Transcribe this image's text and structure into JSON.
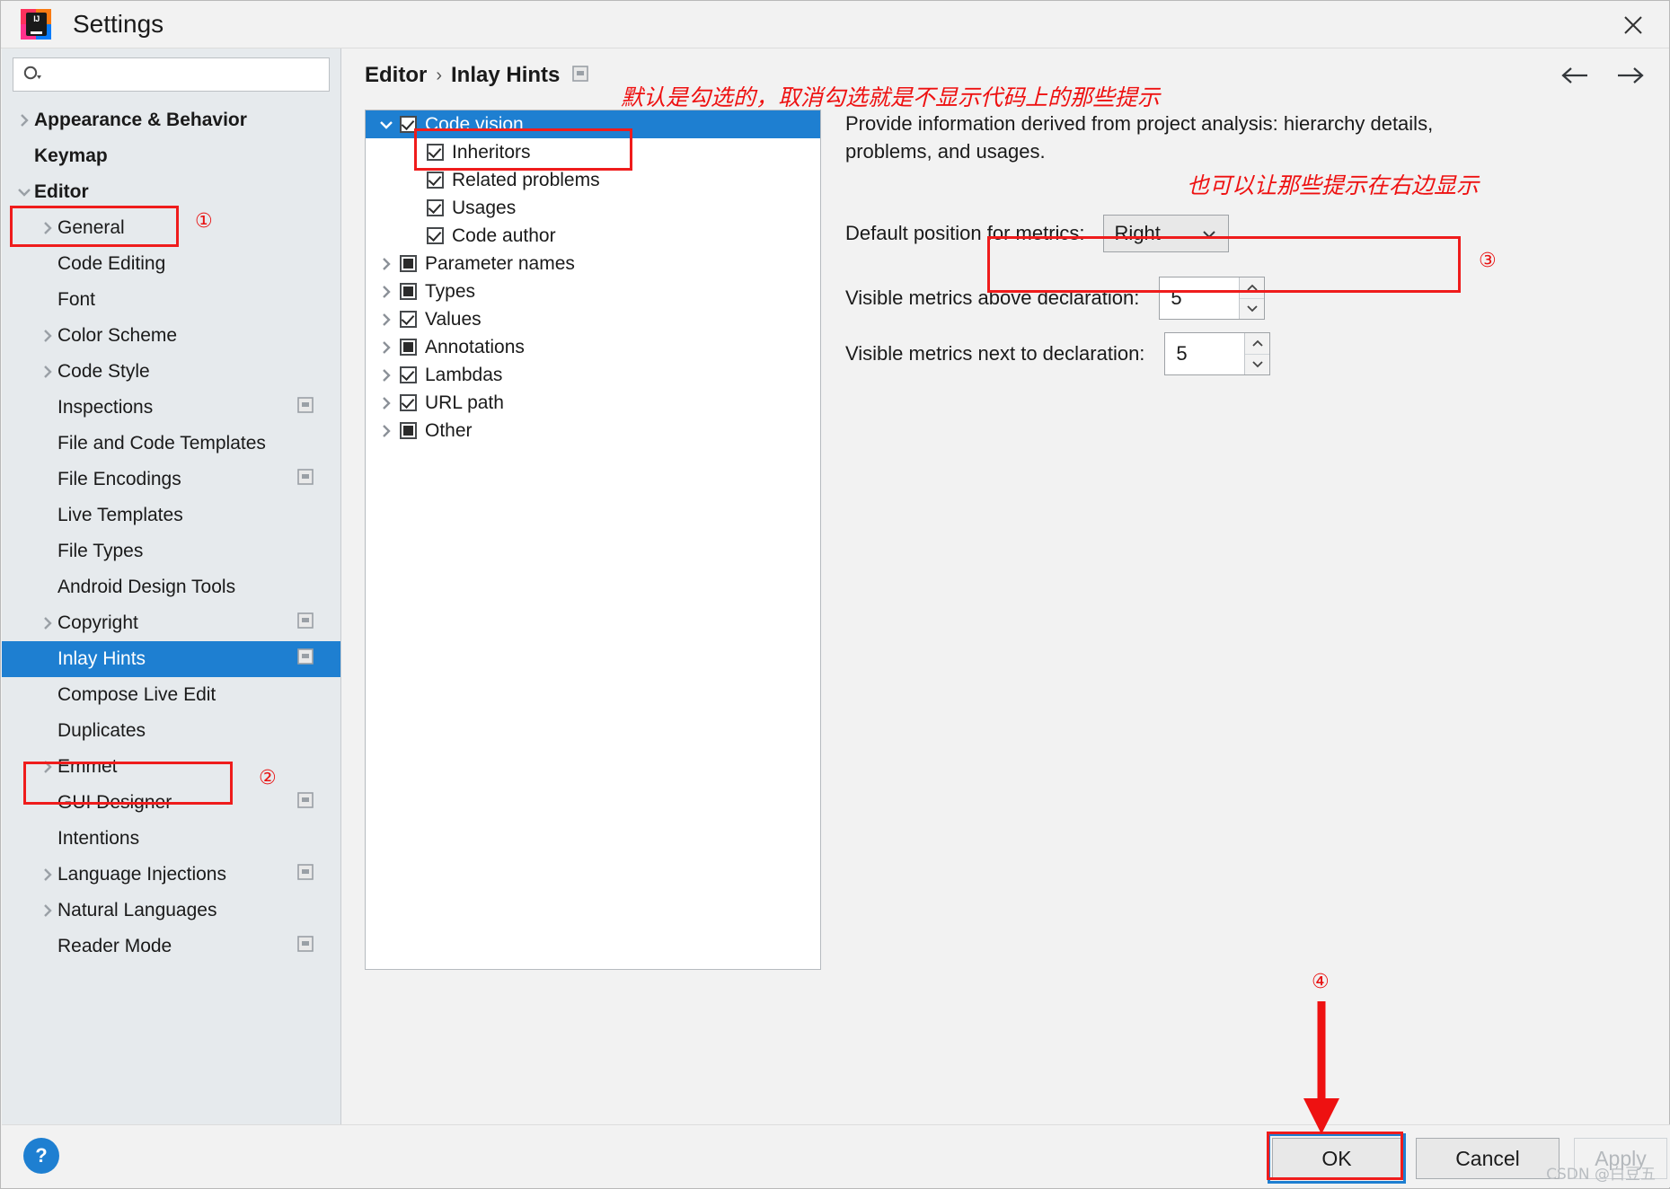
{
  "window": {
    "title": "Settings",
    "logo_text": "IJ",
    "close_icon": "close-icon"
  },
  "search": {
    "value": "",
    "placeholder": "",
    "icon": "search-icon"
  },
  "sidebar": {
    "items": [
      {
        "label": "Appearance & Behavior",
        "indent": 0,
        "twisty": "right",
        "bold": true,
        "selected": false,
        "badge": false
      },
      {
        "label": "Keymap",
        "indent": 0,
        "twisty": "none",
        "bold": true,
        "selected": false,
        "badge": false
      },
      {
        "label": "Editor",
        "indent": 0,
        "twisty": "down",
        "bold": true,
        "selected": false,
        "badge": false
      },
      {
        "label": "General",
        "indent": 1,
        "twisty": "right",
        "bold": false,
        "selected": false,
        "badge": false
      },
      {
        "label": "Code Editing",
        "indent": 1,
        "twisty": "none",
        "bold": false,
        "selected": false,
        "badge": false
      },
      {
        "label": "Font",
        "indent": 1,
        "twisty": "none",
        "bold": false,
        "selected": false,
        "badge": false
      },
      {
        "label": "Color Scheme",
        "indent": 1,
        "twisty": "right",
        "bold": false,
        "selected": false,
        "badge": false
      },
      {
        "label": "Code Style",
        "indent": 1,
        "twisty": "right",
        "bold": false,
        "selected": false,
        "badge": false
      },
      {
        "label": "Inspections",
        "indent": 1,
        "twisty": "none",
        "bold": false,
        "selected": false,
        "badge": true
      },
      {
        "label": "File and Code Templates",
        "indent": 1,
        "twisty": "none",
        "bold": false,
        "selected": false,
        "badge": false
      },
      {
        "label": "File Encodings",
        "indent": 1,
        "twisty": "none",
        "bold": false,
        "selected": false,
        "badge": true
      },
      {
        "label": "Live Templates",
        "indent": 1,
        "twisty": "none",
        "bold": false,
        "selected": false,
        "badge": false
      },
      {
        "label": "File Types",
        "indent": 1,
        "twisty": "none",
        "bold": false,
        "selected": false,
        "badge": false
      },
      {
        "label": "Android Design Tools",
        "indent": 1,
        "twisty": "none",
        "bold": false,
        "selected": false,
        "badge": false
      },
      {
        "label": "Copyright",
        "indent": 1,
        "twisty": "right",
        "bold": false,
        "selected": false,
        "badge": true
      },
      {
        "label": "Inlay Hints",
        "indent": 1,
        "twisty": "none",
        "bold": false,
        "selected": true,
        "badge": true
      },
      {
        "label": "Compose Live Edit",
        "indent": 1,
        "twisty": "none",
        "bold": false,
        "selected": false,
        "badge": false
      },
      {
        "label": "Duplicates",
        "indent": 1,
        "twisty": "none",
        "bold": false,
        "selected": false,
        "badge": false
      },
      {
        "label": "Emmet",
        "indent": 1,
        "twisty": "right",
        "bold": false,
        "selected": false,
        "badge": false
      },
      {
        "label": "GUI Designer",
        "indent": 1,
        "twisty": "none",
        "bold": false,
        "selected": false,
        "badge": true
      },
      {
        "label": "Intentions",
        "indent": 1,
        "twisty": "none",
        "bold": false,
        "selected": false,
        "badge": false
      },
      {
        "label": "Language Injections",
        "indent": 1,
        "twisty": "right",
        "bold": false,
        "selected": false,
        "badge": true
      },
      {
        "label": "Natural Languages",
        "indent": 1,
        "twisty": "right",
        "bold": false,
        "selected": false,
        "badge": false
      },
      {
        "label": "Reader Mode",
        "indent": 1,
        "twisty": "none",
        "bold": false,
        "selected": false,
        "badge": true
      }
    ]
  },
  "breadcrumb": {
    "root": "Editor",
    "separator": "›",
    "current": "Inlay Hints",
    "settings_icon": "settings-page-icon"
  },
  "nav": {
    "back_icon": "arrow-left-icon",
    "forward_icon": "arrow-right-icon"
  },
  "hints_tree": {
    "items": [
      {
        "label": "Code vision",
        "indent": 0,
        "twisty": "down",
        "check": "checked",
        "selected": true
      },
      {
        "label": "Inheritors",
        "indent": 1,
        "twisty": "none",
        "check": "checked",
        "selected": false
      },
      {
        "label": "Related problems",
        "indent": 1,
        "twisty": "none",
        "check": "checked",
        "selected": false
      },
      {
        "label": "Usages",
        "indent": 1,
        "twisty": "none",
        "check": "checked",
        "selected": false
      },
      {
        "label": "Code author",
        "indent": 1,
        "twisty": "none",
        "check": "checked",
        "selected": false
      },
      {
        "label": "Parameter names",
        "indent": 0,
        "twisty": "right",
        "check": "partial",
        "selected": false
      },
      {
        "label": "Types",
        "indent": 0,
        "twisty": "right",
        "check": "partial",
        "selected": false
      },
      {
        "label": "Values",
        "indent": 0,
        "twisty": "right",
        "check": "checked",
        "selected": false
      },
      {
        "label": "Annotations",
        "indent": 0,
        "twisty": "right",
        "check": "partial",
        "selected": false
      },
      {
        "label": "Lambdas",
        "indent": 0,
        "twisty": "right",
        "check": "checked",
        "selected": false
      },
      {
        "label": "URL path",
        "indent": 0,
        "twisty": "right",
        "check": "checked",
        "selected": false
      },
      {
        "label": "Other",
        "indent": 0,
        "twisty": "right",
        "check": "partial",
        "selected": false
      }
    ]
  },
  "detail": {
    "description": "Provide information derived from project analysis: hierarchy details, problems, and usages.",
    "position_label": "Default position for metrics:",
    "position_value": "Right",
    "above_label": "Visible metrics above declaration:",
    "above_value": "5",
    "next_label": "Visible metrics next to declaration:",
    "next_value": "5"
  },
  "annotations": {
    "note1": "默认是勾选的，取消勾选就是不显示代码上的那些提示",
    "note2": "也可以让那些提示在右边显示",
    "marker1": "①",
    "marker2": "②",
    "marker3": "③",
    "marker4": "④"
  },
  "footer": {
    "help_label": "?",
    "ok_label": "OK",
    "cancel_label": "Cancel",
    "apply_label": "Apply",
    "watermark": "CSDN @白豆五"
  },
  "colors": {
    "accent": "#1e7fd1",
    "annotation_red": "#ee1111",
    "sidebar_bg": "#e6eaed"
  }
}
